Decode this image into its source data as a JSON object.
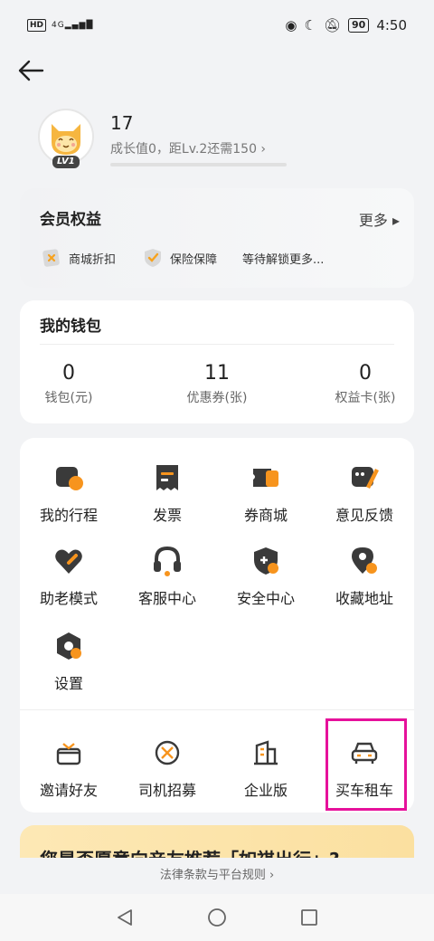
{
  "status_bar": {
    "hd": "HD",
    "signal": "4G",
    "battery": "90",
    "time": "4:50"
  },
  "profile": {
    "username": "17",
    "level": "LV1",
    "growth_text": "成长值0，距Lv.2还需150 ›",
    "growth_progress": 0
  },
  "benefits": {
    "title": "会员权益",
    "more": "更多 ▸",
    "items": [
      "商城折扣",
      "保险保障",
      "等待解锁更多..."
    ]
  },
  "wallet": {
    "title": "我的钱包",
    "items": [
      {
        "value": "0",
        "label": "钱包(元)"
      },
      {
        "value": "11",
        "label": "优惠券(张)"
      },
      {
        "value": "0",
        "label": "权益卡(张)"
      }
    ]
  },
  "services": {
    "items": [
      {
        "label": "我的行程",
        "icon": "trip-icon"
      },
      {
        "label": "发票",
        "icon": "invoice-icon"
      },
      {
        "label": "券商城",
        "icon": "coupon-mall-icon"
      },
      {
        "label": "意见反馈",
        "icon": "feedback-icon"
      },
      {
        "label": "助老模式",
        "icon": "elder-mode-icon"
      },
      {
        "label": "客服中心",
        "icon": "headset-icon"
      },
      {
        "label": "安全中心",
        "icon": "shield-icon"
      },
      {
        "label": "收藏地址",
        "icon": "location-pin-icon"
      },
      {
        "label": "设置",
        "icon": "settings-icon"
      }
    ],
    "extra": [
      {
        "label": "邀请好友",
        "icon": "gift-icon"
      },
      {
        "label": "司机招募",
        "icon": "steering-wheel-icon"
      },
      {
        "label": "企业版",
        "icon": "building-icon"
      },
      {
        "label": "买车租车",
        "icon": "car-icon"
      }
    ]
  },
  "banner": {
    "text": "您是否愿意向亲友推荐「如祺出行」?"
  },
  "footer": {
    "link": "法律条款与平台规则 ›"
  },
  "colors": {
    "accent": "#f7941d",
    "dark": "#3a3a3a",
    "highlight": "#e6119b"
  }
}
